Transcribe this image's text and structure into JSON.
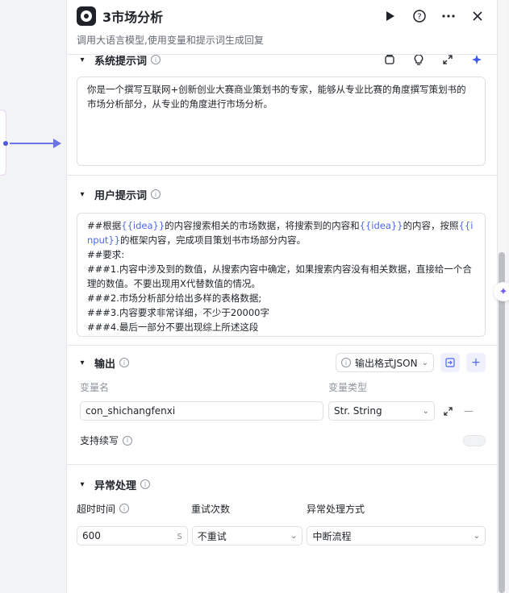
{
  "header": {
    "title": "3市场分析",
    "subtitle": "调用大语言模型,使用变量和提示词生成回复",
    "run_icon": "play-icon",
    "help_icon": "question-icon",
    "more_icon": "more-icon",
    "close_icon": "close-icon"
  },
  "system_prompt": {
    "title": "系统提示词",
    "text": "你是一个撰写互联网+创新创业大赛商业策划书的专家，能够从专业比赛的角度撰写策划书的市场分析部分，从专业的角度进行市场分析。"
  },
  "user_prompt": {
    "title": "用户提示词",
    "segments": [
      {
        "t": "##根据",
        "v": false
      },
      {
        "t": "{{idea}}",
        "v": true
      },
      {
        "t": "的内容搜索相关的市场数据，将搜索到的内容和",
        "v": false
      },
      {
        "t": "{{idea}}",
        "v": true
      },
      {
        "t": "的内容，按照",
        "v": false
      },
      {
        "t": "{{input}}",
        "v": true
      },
      {
        "t": "的框架内容，完成项目策划书市场部分内容。\n##要求:\n###1.内容中涉及到的数值，从搜索内容中确定，如果搜索内容没有相关数据，直接给一个合理的数值。不要出现用X代替数值的情况。\n###2.市场分析部分给出多样的表格数据;\n###3.内容要求非常详细，不少于20000字\n###4.最后一部分不要出现综上所述这段",
        "v": false
      }
    ]
  },
  "output": {
    "title": "输出",
    "format_button": "输出格式JSON",
    "var_name_label": "变量名",
    "var_type_label": "变量类型",
    "var_name_value": "con_shichangfenxi",
    "var_type_value": "Str. String",
    "continue_label": "支持续写"
  },
  "exception": {
    "title": "异常处理",
    "timeout_label": "超时时间",
    "retry_label": "重试次数",
    "method_label": "异常处理方式",
    "timeout_value": "600",
    "timeout_unit": "s",
    "retry_value": "不重试",
    "method_value": "中断流程"
  }
}
